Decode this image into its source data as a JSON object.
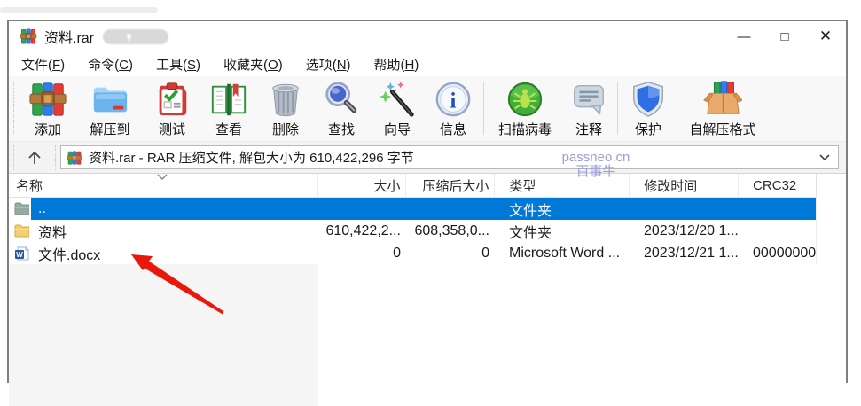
{
  "window": {
    "title": "资料.rar",
    "controls": {
      "minimize": "—",
      "maximize": "□",
      "close": "✕"
    }
  },
  "menu": {
    "items": [
      {
        "pre": "文件(",
        "key": "F",
        "post": ")"
      },
      {
        "pre": "命令(",
        "key": "C",
        "post": ")"
      },
      {
        "pre": "工具(",
        "key": "S",
        "post": ")"
      },
      {
        "pre": "收藏夹(",
        "key": "O",
        "post": ")"
      },
      {
        "pre": "选项(",
        "key": "N",
        "post": ")"
      },
      {
        "pre": "帮助(",
        "key": "H",
        "post": ")"
      }
    ]
  },
  "toolbar": {
    "buttons": [
      {
        "label": "添加",
        "icon": "winrar-add-icon"
      },
      {
        "label": "解压到",
        "icon": "extract-to-icon"
      },
      {
        "label": "测试",
        "icon": "test-icon"
      },
      {
        "label": "查看",
        "icon": "view-icon"
      },
      {
        "label": "删除",
        "icon": "delete-icon"
      },
      {
        "label": "查找",
        "icon": "find-icon"
      },
      {
        "label": "向导",
        "icon": "wizard-icon"
      },
      {
        "label": "信息",
        "icon": "info-icon"
      },
      {
        "label": "扫描病毒",
        "icon": "virus-scan-icon"
      },
      {
        "label": "注释",
        "icon": "comment-icon"
      },
      {
        "label": "保护",
        "icon": "protect-icon"
      },
      {
        "label": "自解压格式",
        "icon": "sfx-icon"
      }
    ]
  },
  "addressbar": {
    "path_text": "资料.rar - RAR 压缩文件, 解包大小为 610,422,296 字节"
  },
  "watermark": {
    "line1": "passneo.cn",
    "line2": "百事牛",
    "color": "#9c9cdb"
  },
  "table": {
    "columns": {
      "name": "名称",
      "size": "大小",
      "packed": "压缩后大小",
      "type": "类型",
      "modified": "修改时间",
      "crc": "CRC32"
    },
    "rows": [
      {
        "name": "..",
        "size": "",
        "packed": "",
        "type": "文件夹",
        "modified": "",
        "crc": "",
        "icon": "folder-up-icon",
        "selected": true
      },
      {
        "name": "资料",
        "size": "610,422,2...",
        "packed": "608,358,0...",
        "type": "文件夹",
        "modified": "2023/12/20 1...",
        "crc": "",
        "icon": "folder-icon",
        "selected": false
      },
      {
        "name": "文件.docx",
        "size": "0",
        "packed": "0",
        "type": "Microsoft Word ...",
        "modified": "2023/12/21 1...",
        "crc": "00000000",
        "icon": "word-doc-icon",
        "selected": false
      }
    ]
  },
  "annotation": {
    "type": "red-arrow",
    "color": "#e8190c"
  },
  "colors": {
    "selection": "#0078d7",
    "toolbar_bg": "#f8f8f8"
  }
}
